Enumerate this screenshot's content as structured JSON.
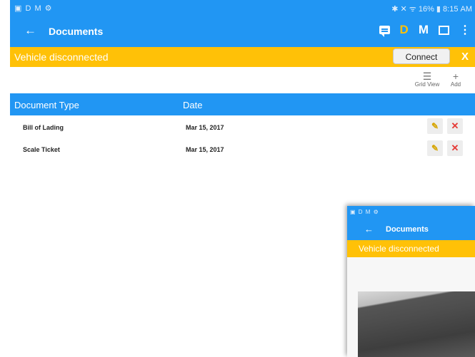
{
  "statusbar": {
    "left_icons": "▣ D M ⚙",
    "right_text": "✱ ✕ ᯤ 16% ▮ 8:15 AM"
  },
  "appbar": {
    "back": "←",
    "title": "Documents",
    "d_label": "D",
    "m_label": "M",
    "more": "⋮"
  },
  "banner": {
    "message": "Vehicle disconnected",
    "connect_label": "Connect",
    "close_label": "X"
  },
  "toolbar": {
    "grid_view_label": "Grid View",
    "add_label": "Add",
    "grid_glyph": "☰",
    "add_glyph": "+"
  },
  "table": {
    "headers": [
      "Document Type",
      "Date"
    ],
    "rows": [
      {
        "type": "Bill of Lading",
        "date": "Mar 15, 2017"
      },
      {
        "type": "Scale Ticket",
        "date": "Mar 15, 2017"
      }
    ],
    "edit_glyph": "✎",
    "delete_glyph": "✕"
  },
  "overlay": {
    "status_icons": "▣ D M ⚙",
    "back": "←",
    "title": "Documents",
    "banner": "Vehicle disconnected"
  },
  "colors": {
    "primary": "#2196f3",
    "warning": "#ffc107",
    "delete": "#e53935"
  }
}
